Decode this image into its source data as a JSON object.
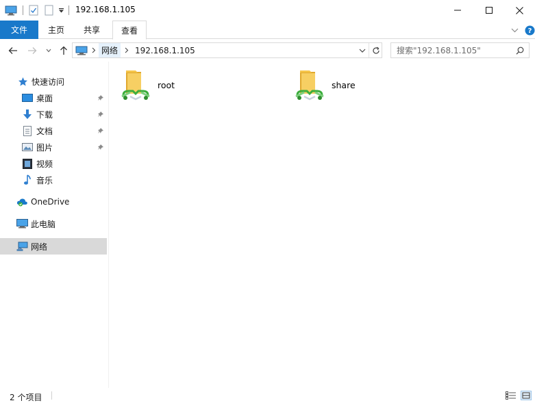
{
  "window": {
    "title": "192.168.1.105",
    "minimize_icon": "minimize-icon",
    "maximize_icon": "maximize-icon",
    "close_icon": "close-icon"
  },
  "ribbon": {
    "tabs": [
      {
        "label": "文件"
      },
      {
        "label": "主页"
      },
      {
        "label": "共享"
      },
      {
        "label": "查看"
      }
    ]
  },
  "address": {
    "segments": [
      {
        "label": "网络"
      },
      {
        "label": "192.168.1.105"
      }
    ]
  },
  "search": {
    "placeholder": "搜索\"192.168.1.105\""
  },
  "sidebar": {
    "quick_access": "快速访问",
    "pinned": [
      {
        "label": "桌面"
      },
      {
        "label": "下载"
      },
      {
        "label": "文档"
      },
      {
        "label": "图片"
      }
    ],
    "others": [
      {
        "label": "视频"
      },
      {
        "label": "音乐"
      }
    ],
    "onedrive": "OneDrive",
    "this_pc": "此电脑",
    "network": "网络"
  },
  "content": {
    "items": [
      {
        "name": "root",
        "icon": "shared-folder-icon"
      },
      {
        "name": "share",
        "icon": "shared-folder-icon"
      }
    ]
  },
  "status": {
    "item_count": "2 个项目"
  },
  "colors": {
    "accent": "#1979ca",
    "selected_bg": "#d9d9d9",
    "folder": "#f5c54b",
    "share_green": "#3cad3c"
  }
}
